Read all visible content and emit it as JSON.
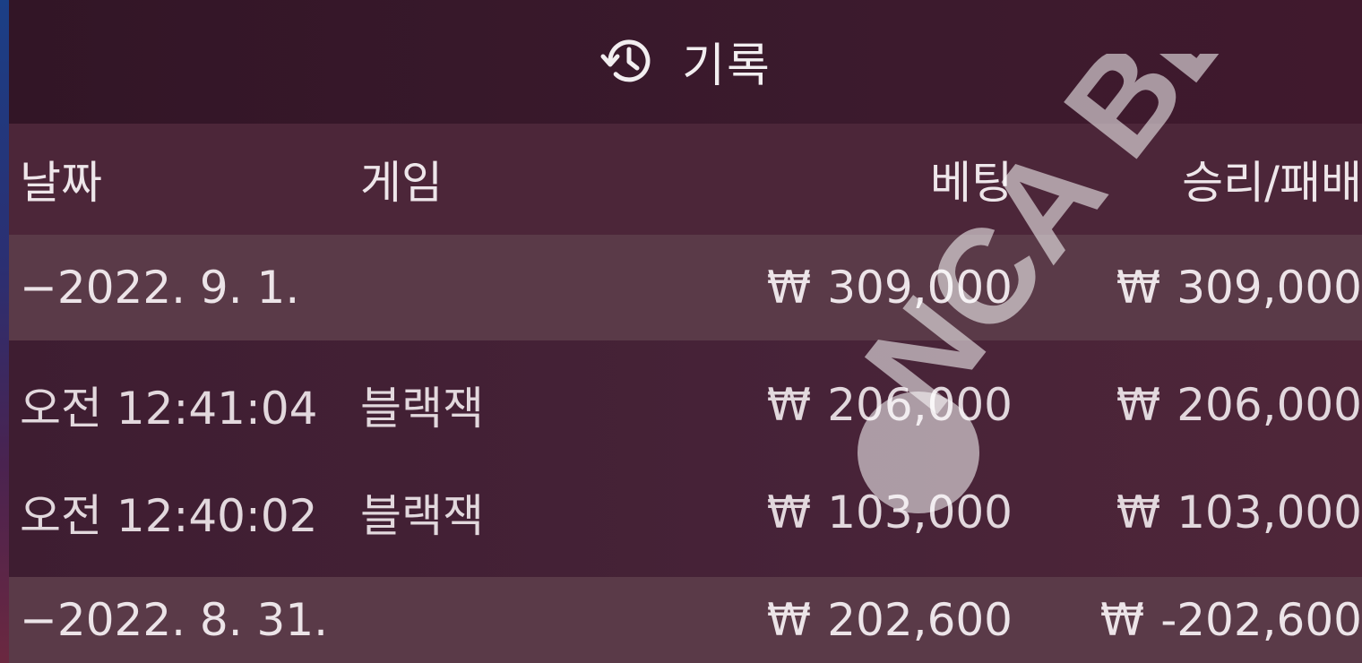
{
  "header": {
    "title": "기록",
    "icon": "history-icon"
  },
  "columns": {
    "date": "날짜",
    "game": "게임",
    "bet": "베팅",
    "result": "승리/패배"
  },
  "rows": [
    {
      "type": "date-group",
      "date": "−2022. 9. 1.",
      "game": "",
      "bet_currency": "₩",
      "bet": "309,000",
      "result_currency": "₩",
      "result": "309,000"
    },
    {
      "type": "entry",
      "date": "오전 12:41:04",
      "game": "블랙잭",
      "bet_currency": "₩",
      "bet": "206,000",
      "result_currency": "₩",
      "result": "206,000"
    },
    {
      "type": "entry",
      "date": "오전 12:40:02",
      "game": "블랙잭",
      "bet_currency": "₩",
      "bet": "103,000",
      "result_currency": "₩",
      "result": "103,000"
    },
    {
      "type": "date-group",
      "date": "−2022. 8. 31.",
      "game": "",
      "bet_currency": "₩",
      "bet": "202,600",
      "result_currency": "₩",
      "result": "-202,600"
    }
  ],
  "watermark": {
    "text": "NCA BEST"
  },
  "colors": {
    "background": "#3c1e31",
    "band": "#5a3a48",
    "text": "#ece4e8"
  }
}
